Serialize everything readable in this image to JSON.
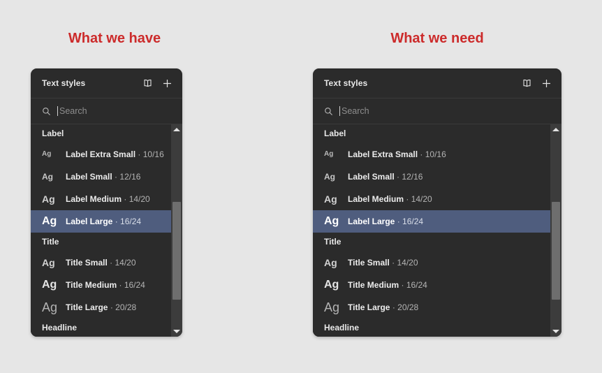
{
  "captions": {
    "have": "What we have",
    "need": "What we need",
    "accent_color": "#cc2b2b"
  },
  "colors": {
    "page_background": "#e6e6e6",
    "panel_background": "#2b2b2b",
    "selection": "#4f5d7e",
    "scrollbar_track": "#3c3c3c",
    "scrollbar_thumb": "#6e6e6e"
  },
  "panel": {
    "title": "Text styles",
    "icons": {
      "library": "book-icon",
      "add": "plus-icon"
    },
    "search": {
      "icon": "search-icon",
      "placeholder": "Search",
      "value": ""
    },
    "groups": [
      {
        "name": "Label",
        "items": [
          {
            "preview": "Ag",
            "label": "Label Extra Small",
            "separator": "·",
            "metrics": "10/16",
            "size": 10,
            "selected": false
          },
          {
            "preview": "Ag",
            "label": "Label Small",
            "separator": "·",
            "metrics": "12/16",
            "size": 12,
            "selected": false
          },
          {
            "preview": "Ag",
            "label": "Label Medium",
            "separator": "·",
            "metrics": "14/20",
            "size": 14,
            "selected": false
          },
          {
            "preview": "Ag",
            "label": "Label Large",
            "separator": "·",
            "metrics": "16/24",
            "size": 16,
            "selected": true
          }
        ]
      },
      {
        "name": "Title",
        "items": [
          {
            "preview": "Ag",
            "label": "Title Small",
            "separator": "·",
            "metrics": "14/20",
            "size": 14,
            "selected": false
          },
          {
            "preview": "Ag",
            "label": "Title Medium",
            "separator": "·",
            "metrics": "16/24",
            "size": 16,
            "selected": false
          },
          {
            "preview": "Ag",
            "label": "Title Large",
            "separator": "·",
            "metrics": "20/28",
            "size": 20,
            "selected": false
          }
        ]
      },
      {
        "name": "Headline",
        "items": []
      }
    ],
    "scrollbar": {
      "up_arrow": "triangle-up-icon",
      "down_arrow": "triangle-down-icon"
    }
  }
}
